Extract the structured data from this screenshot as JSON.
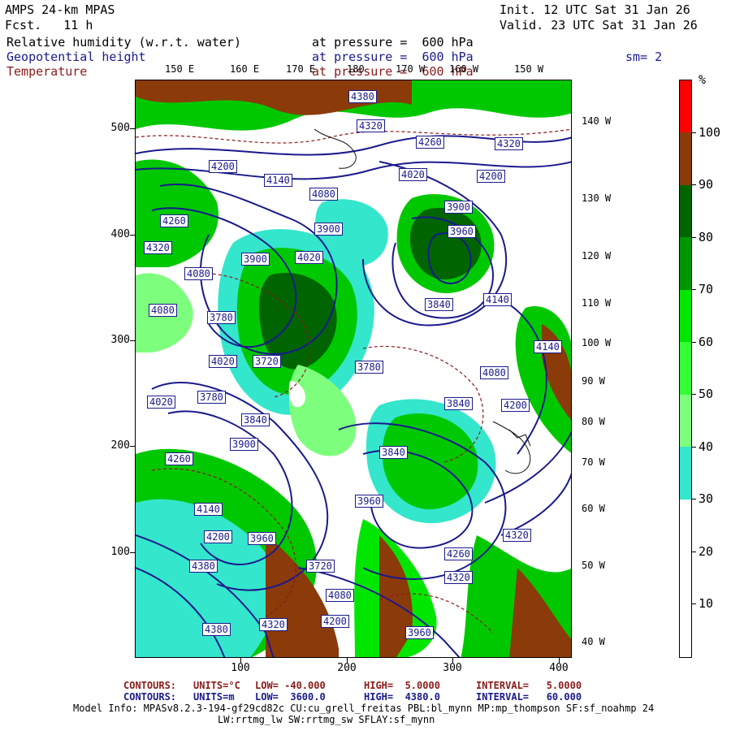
{
  "header": {
    "model": "AMPS 24-km MPAS",
    "fcst": "Fcst.   11 h",
    "init": "Init. 12 UTC Sat 31 Jan 26",
    "valid": "Valid. 23 UTC Sat 31 Jan 26",
    "var1_name": "Relative humidity (w.r.t. water)",
    "var1_level": "at pressure =  600 hPa",
    "var2_name": "Geopotential height",
    "var2_level": "at pressure =  600 hPa",
    "var2_sm": "sm= 2",
    "var3_name": "Temperature",
    "var3_level": "at pressure =  600 hPa"
  },
  "colors": {
    "navy": "#1a1a8c",
    "darkred": "#8b1a1a",
    "rh_30": "#33e6cc",
    "rh_40": "#7dff7d",
    "rh_50": "#00e600",
    "rh_60": "#00c800",
    "rh_70": "#009600",
    "rh_80": "#006400",
    "rh_90": "#8b3a0a",
    "rh_100": "#ff0000"
  },
  "color_scale": {
    "unit": "%",
    "labels": [
      "10",
      "20",
      "30",
      "40",
      "50",
      "60",
      "70",
      "80",
      "90",
      "100"
    ]
  },
  "axes": {
    "x_ticks": [
      "100",
      "200",
      "300",
      "400"
    ],
    "y_ticks": [
      "100",
      "200",
      "300",
      "400",
      "500"
    ],
    "top_lon": [
      "150 E",
      "160 E",
      "170 E",
      "180",
      "170 W",
      "160 W",
      "150 W"
    ],
    "right_lon": [
      "140 W",
      "130 W",
      "120 W",
      "110 W",
      "100 W",
      "90 W",
      "80 W",
      "70 W",
      "60 W",
      "50 W",
      "40 W"
    ]
  },
  "contour_labels": [
    "4380",
    "4320",
    "4260",
    "4320",
    "4200",
    "4140",
    "4080",
    "4020",
    "3960",
    "3900",
    "4200",
    "4260",
    "4320",
    "3900",
    "3900",
    "4080",
    "4020",
    "3840",
    "4140",
    "3780",
    "4080",
    "3720",
    "4020",
    "3780",
    "4080",
    "4140",
    "3780",
    "4020",
    "3840",
    "3840",
    "4200",
    "3900",
    "3840",
    "4260",
    "3960",
    "3960",
    "4320",
    "4140",
    "4260",
    "4200",
    "4320",
    "4380",
    "4320",
    "4380",
    "4200",
    "4080",
    "3960",
    "3720"
  ],
  "footer": {
    "c1_label": "CONTOURS:",
    "c1_units": "UNITS=°C",
    "c1_low": "LOW= -40.000",
    "c1_high": "HIGH=  5.0000",
    "c1_interval": "INTERVAL=   5.0000",
    "c2_label": "CONTOURS:",
    "c2_units": "UNITS=m",
    "c2_low": "LOW=  3600.0",
    "c2_high": "HIGH=  4380.0",
    "c2_interval": "INTERVAL=   60.000",
    "model_info": "Model Info: MPASv8.2.3-194-gf29cd82c CU:cu_grell_freitas PBL:bl_mynn MP:mp_thompson SF:sf_noahmp 24",
    "model_info2": "LW:rrtmg_lw SW:rrtmg_sw SFLAY:sf_mynn"
  }
}
